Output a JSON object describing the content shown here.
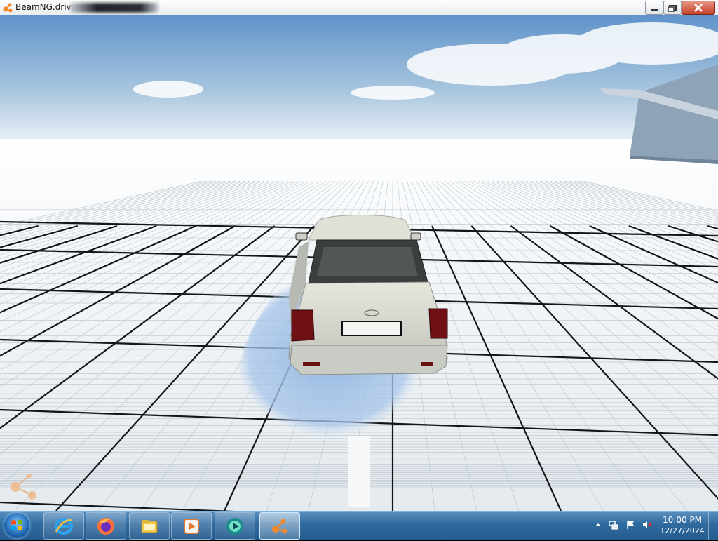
{
  "window": {
    "title": "BeamNG.drive",
    "app_icon": "beamng-logo-icon",
    "controls": [
      "minimize-icon",
      "maximize-icon",
      "close-icon"
    ]
  },
  "scene": {
    "description_icons": [
      "car",
      "grid-floor",
      "ramp",
      "sky"
    ],
    "axis_gizmo_icon": "axis-gizmo-icon"
  },
  "taskbar": {
    "start_icon": "windows-start-icon",
    "pinned": [
      {
        "name": "internet-explorer-icon"
      },
      {
        "name": "firefox-icon"
      },
      {
        "name": "file-explorer-icon"
      },
      {
        "name": "media-player-icon"
      },
      {
        "name": "beamng-launcher-icon"
      },
      {
        "name": "beamng-drive-icon",
        "active": true
      }
    ],
    "tray_icons": [
      "show-hidden-icons-icon",
      "network-icon",
      "action-center-flag-icon",
      "volume-muted-icon"
    ],
    "clock": {
      "time": "10:00 PM",
      "date": "12/27/2024"
    }
  },
  "colors": {
    "taskbar": "#2f6a9f",
    "sky_top": "#5f93c9",
    "grid_line": "#0f1418",
    "car_body": "#d9dbd2",
    "brand_orange": "#f08a2c"
  }
}
